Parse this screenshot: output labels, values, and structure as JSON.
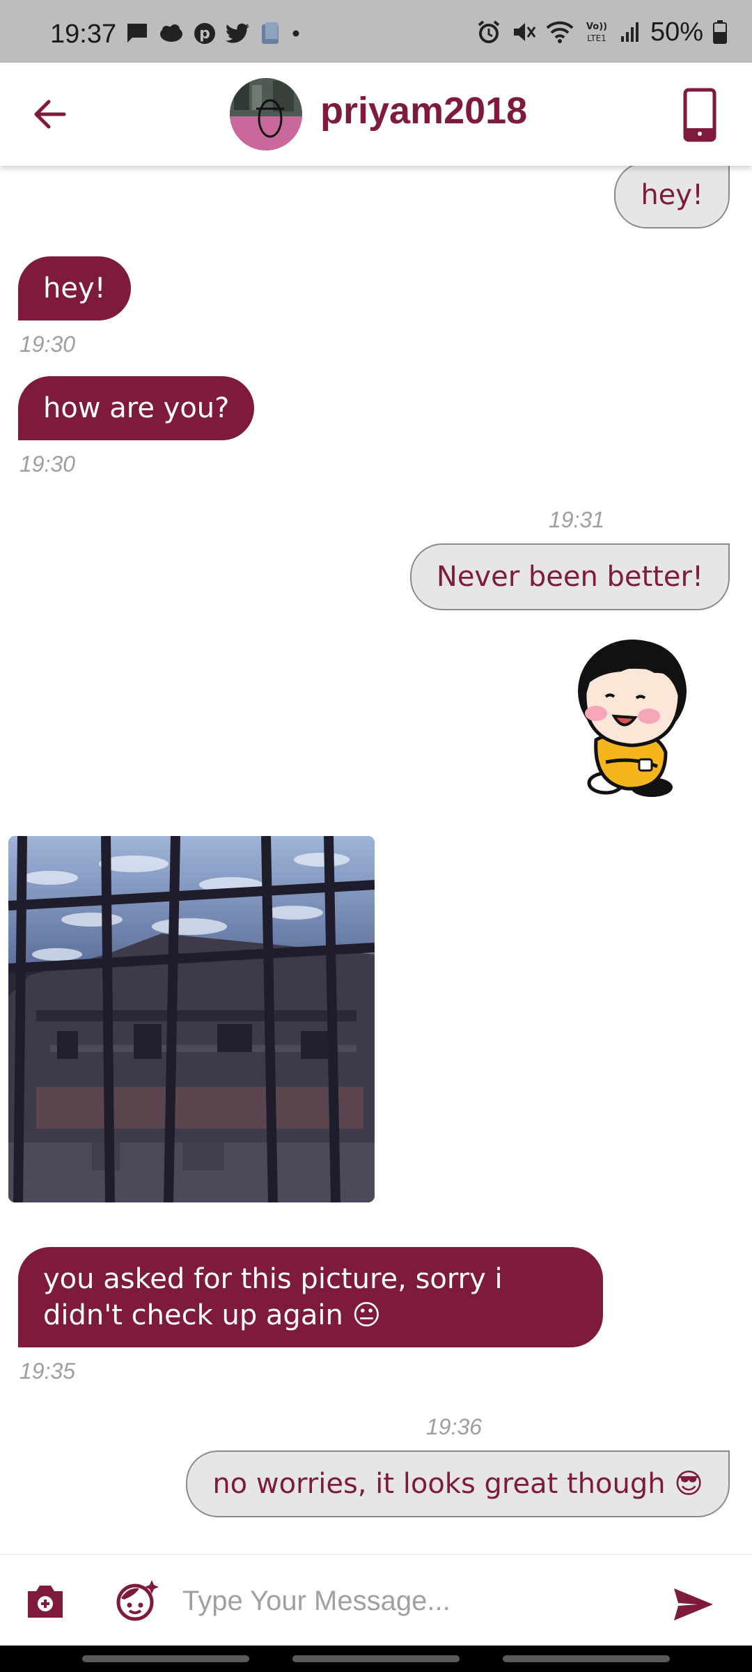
{
  "status_bar": {
    "time": "19:37",
    "battery": "50%",
    "notification_icons": [
      "chat-icon",
      "cloud-icon",
      "pinterest-icon",
      "twitter-icon",
      "photo-icon",
      "dot-icon"
    ],
    "system_icons": [
      "alarm-icon",
      "mute-icon",
      "wifi-icon",
      "volte-icon",
      "signal-icon",
      "battery-icon"
    ]
  },
  "header": {
    "contact_name": "priyam2018",
    "accent": "#7f1a3f"
  },
  "messages": [
    {
      "side": "out",
      "text": "hey!"
    },
    {
      "side": "in",
      "text": "hey!",
      "time": "19:30"
    },
    {
      "side": "in",
      "text": "how are you?",
      "time": "19:30"
    },
    {
      "side": "out",
      "text": "Never been better!",
      "time": "19:31"
    },
    {
      "side": "out",
      "type": "sticker"
    },
    {
      "side": "in",
      "type": "image"
    },
    {
      "side": "in",
      "text": "you asked for this picture, sorry i didn't check up again 😐",
      "time": "19:35"
    },
    {
      "side": "out",
      "text": "no worries, it looks great though 😎",
      "time": "19:36"
    }
  ],
  "input": {
    "placeholder": "Type Your Message..."
  },
  "colors": {
    "incoming_bubble": "#7f1a3f",
    "outgoing_bubble": "#e6e6e6",
    "status_bar": "#bdbdbd"
  }
}
